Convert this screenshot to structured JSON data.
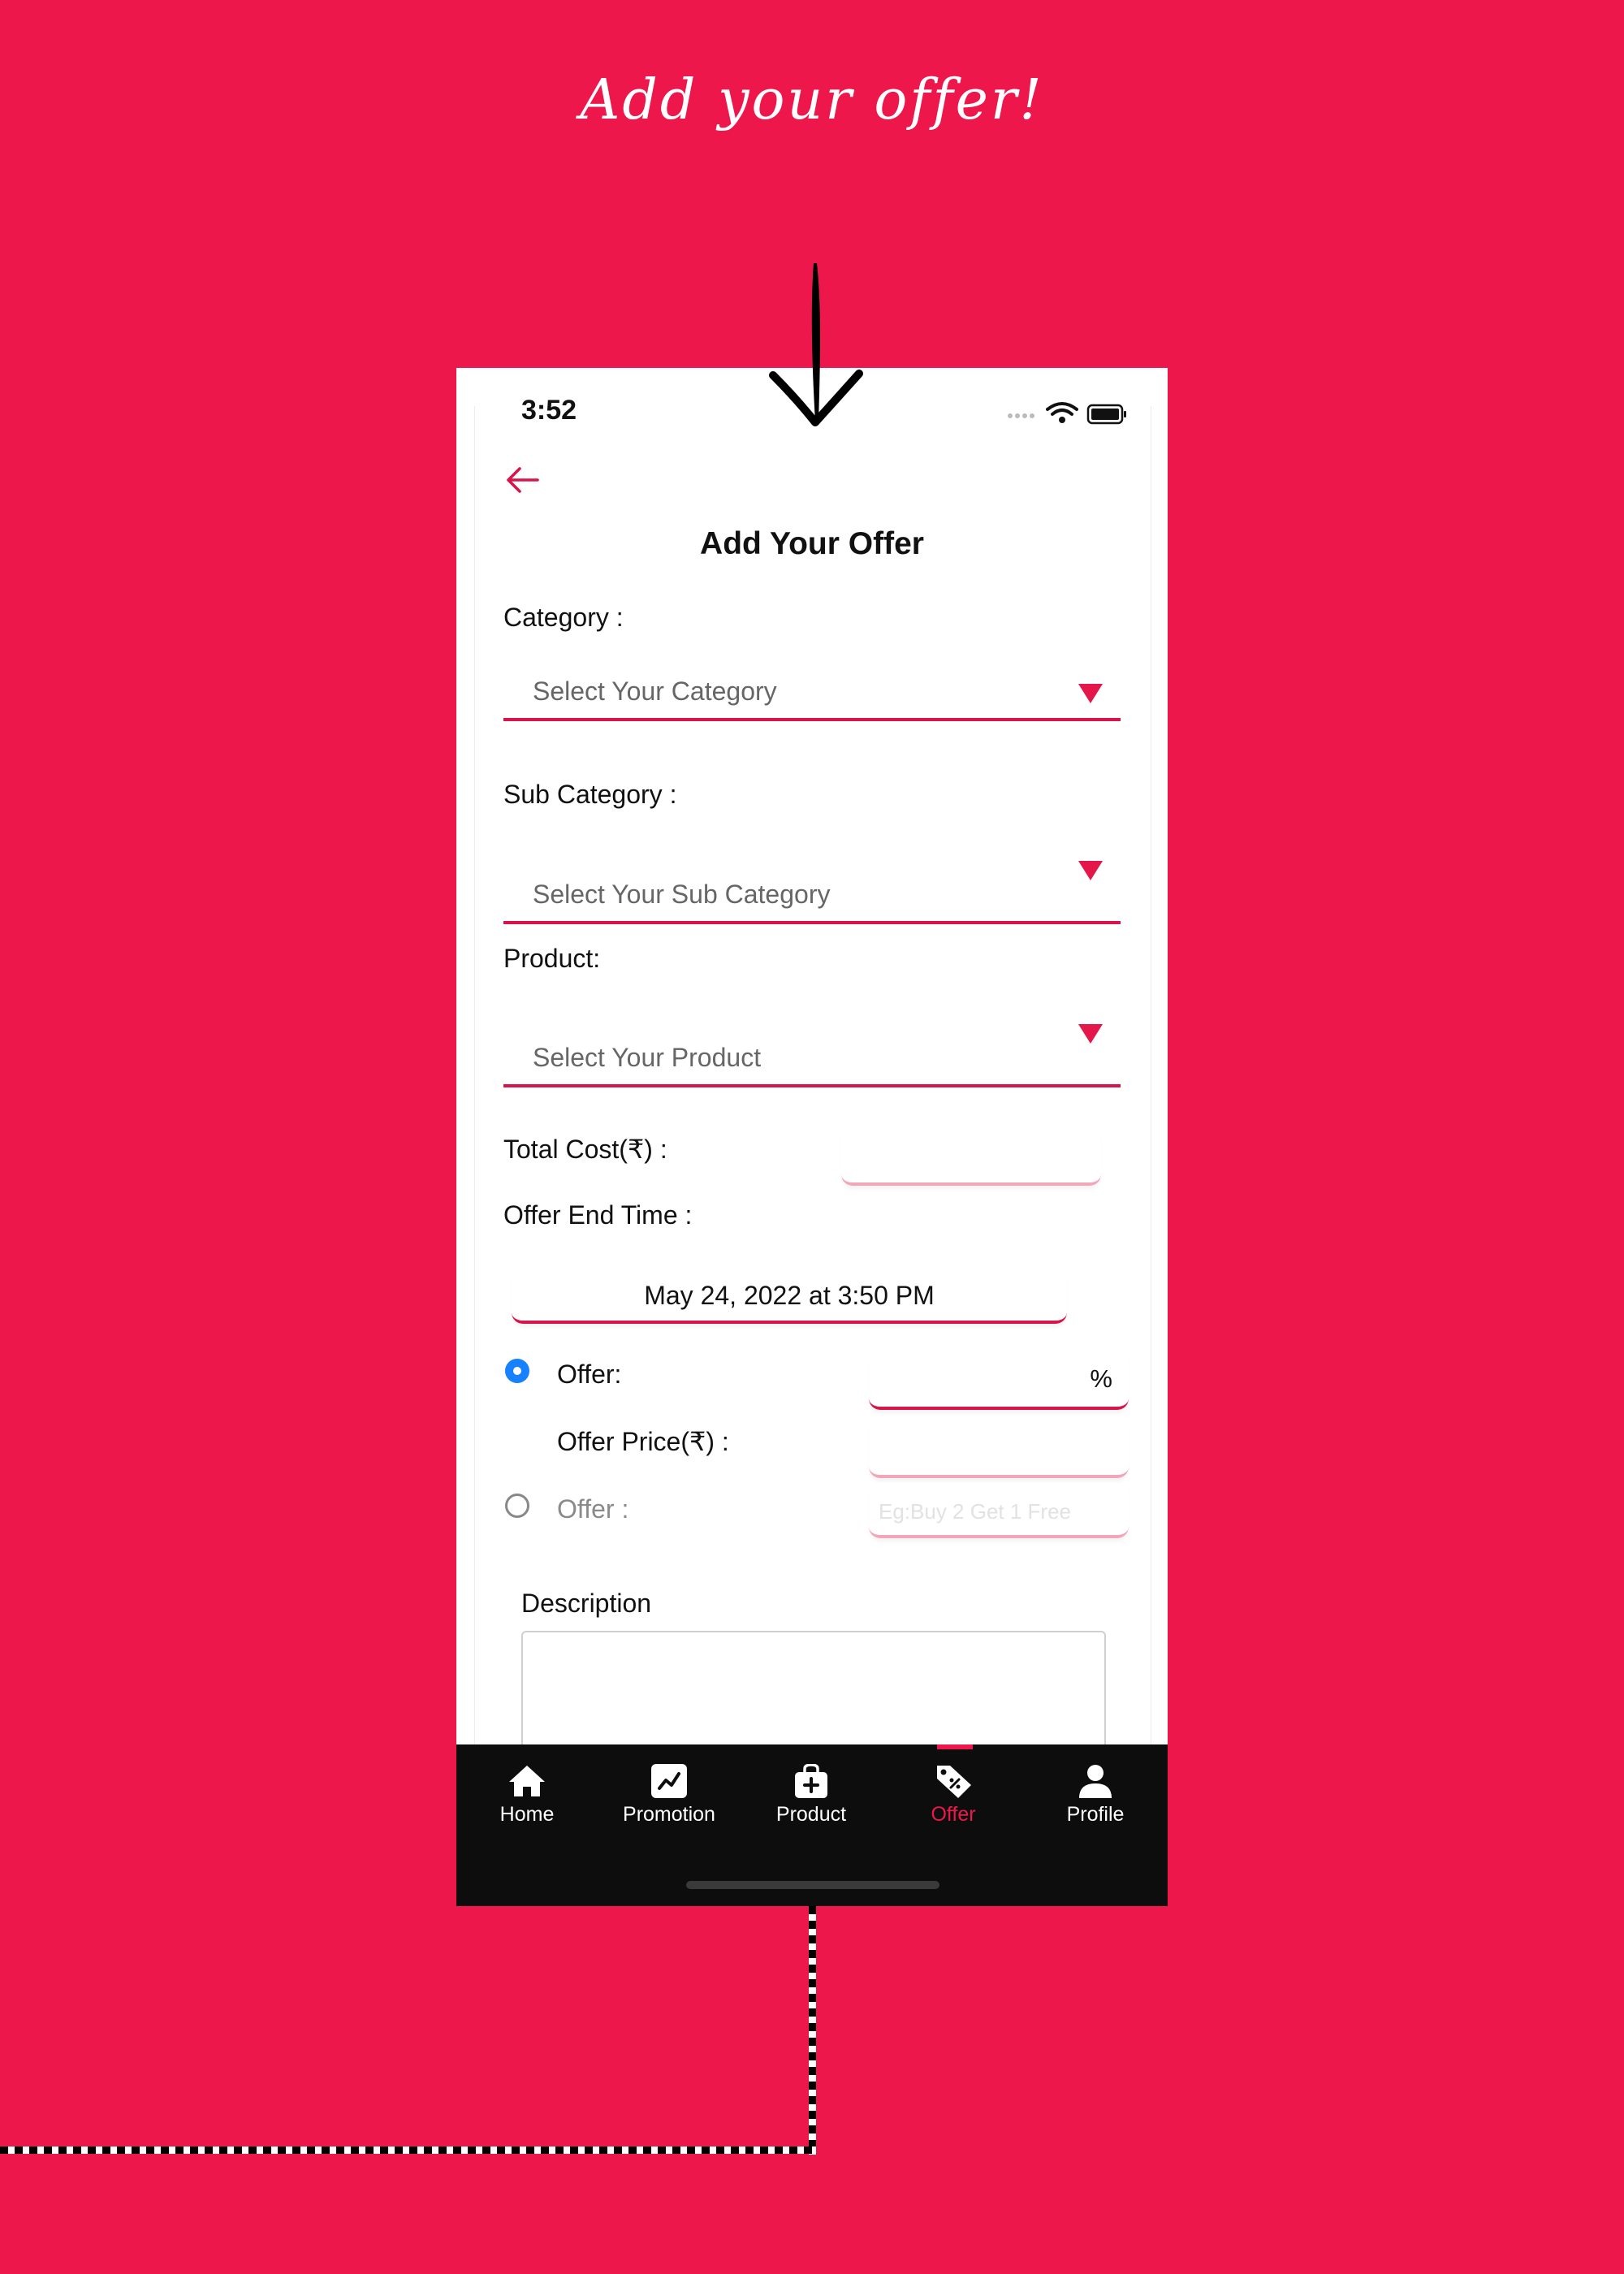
{
  "headline": "Add your offer!",
  "status_bar": {
    "time": "3:52"
  },
  "screen": {
    "title": "Add Your Offer",
    "category": {
      "label": "Category :",
      "placeholder": "Select Your Category"
    },
    "sub_category": {
      "label": "Sub Category :",
      "placeholder": "Select Your Sub Category"
    },
    "product": {
      "label": "Product:",
      "placeholder": "Select Your Product"
    },
    "total_cost": {
      "label": "Total Cost(₹) :",
      "value": ""
    },
    "offer_end_time": {
      "label": "Offer End Time :",
      "value": "May 24, 2022 at 3:50 PM"
    },
    "offer_percent": {
      "label": "Offer:",
      "suffix": "%",
      "selected": true
    },
    "offer_price": {
      "label": "Offer Price(₹) :",
      "value": ""
    },
    "offer_text": {
      "label": "Offer :",
      "placeholder": "Eg:Buy 2 Get 1 Free",
      "selected": false
    },
    "description": {
      "label": "Description",
      "value": ""
    }
  },
  "bottom_nav": {
    "items": [
      {
        "label": "Home",
        "icon": "home-icon"
      },
      {
        "label": "Promotion",
        "icon": "promotion-chart-icon"
      },
      {
        "label": "Product",
        "icon": "product-bag-icon"
      },
      {
        "label": "Offer",
        "icon": "offer-tag-icon",
        "active": true
      },
      {
        "label": "Profile",
        "icon": "profile-icon"
      }
    ]
  },
  "colors": {
    "brand": "#ED174B",
    "radio_selected": "#1782FF",
    "navbar": "#0D0D0D"
  }
}
